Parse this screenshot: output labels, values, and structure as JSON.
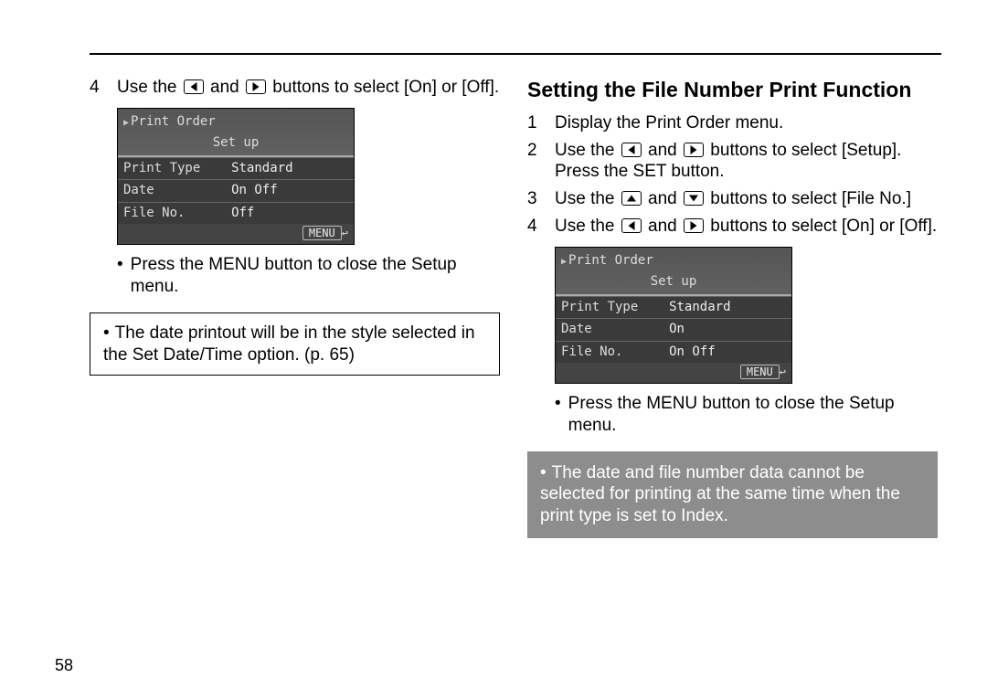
{
  "page_number": "58",
  "left": {
    "step4_num": "4",
    "step4_a": "Use the ",
    "step4_b": " and ",
    "step4_c": " buttons to select [On] or [Off].",
    "screenshot": {
      "title": "Print Order",
      "setup": "Set up",
      "rows": [
        {
          "lab": "Print Type",
          "val": "Standard"
        },
        {
          "lab": "Date",
          "val": "On  Off"
        },
        {
          "lab": "File No.",
          "val": "Off"
        }
      ],
      "menu": "MENU"
    },
    "press_menu": "Press the MENU button to close the Setup menu.",
    "note": "The date printout will be in the style selected in the Set Date/Time option. (p. 65)"
  },
  "right": {
    "heading": "Setting the File Number Print Function",
    "step1_num": "1",
    "step1": "Display the Print Order menu.",
    "step2_num": "2",
    "step2_a": "Use the ",
    "step2_b": " and ",
    "step2_c": " buttons to select [Setup]. Press the SET button.",
    "step3_num": "3",
    "step3_a": "Use the ",
    "step3_b": " and ",
    "step3_c": " buttons to select [File No.]",
    "step4_num": "4",
    "step4_a": "Use the ",
    "step4_b": " and ",
    "step4_c": " buttons to select [On] or [Off].",
    "screenshot": {
      "title": "Print Order",
      "setup": "Set up",
      "rows": [
        {
          "lab": "Print Type",
          "val": "Standard"
        },
        {
          "lab": "Date",
          "val": "On"
        },
        {
          "lab": "File No.",
          "val": "On  Off"
        }
      ],
      "menu": "MENU"
    },
    "press_menu": "Press the MENU button to close the Setup menu.",
    "gray_note": "The date and file number data cannot be selected for printing at the same time when the print type is set to Index."
  }
}
